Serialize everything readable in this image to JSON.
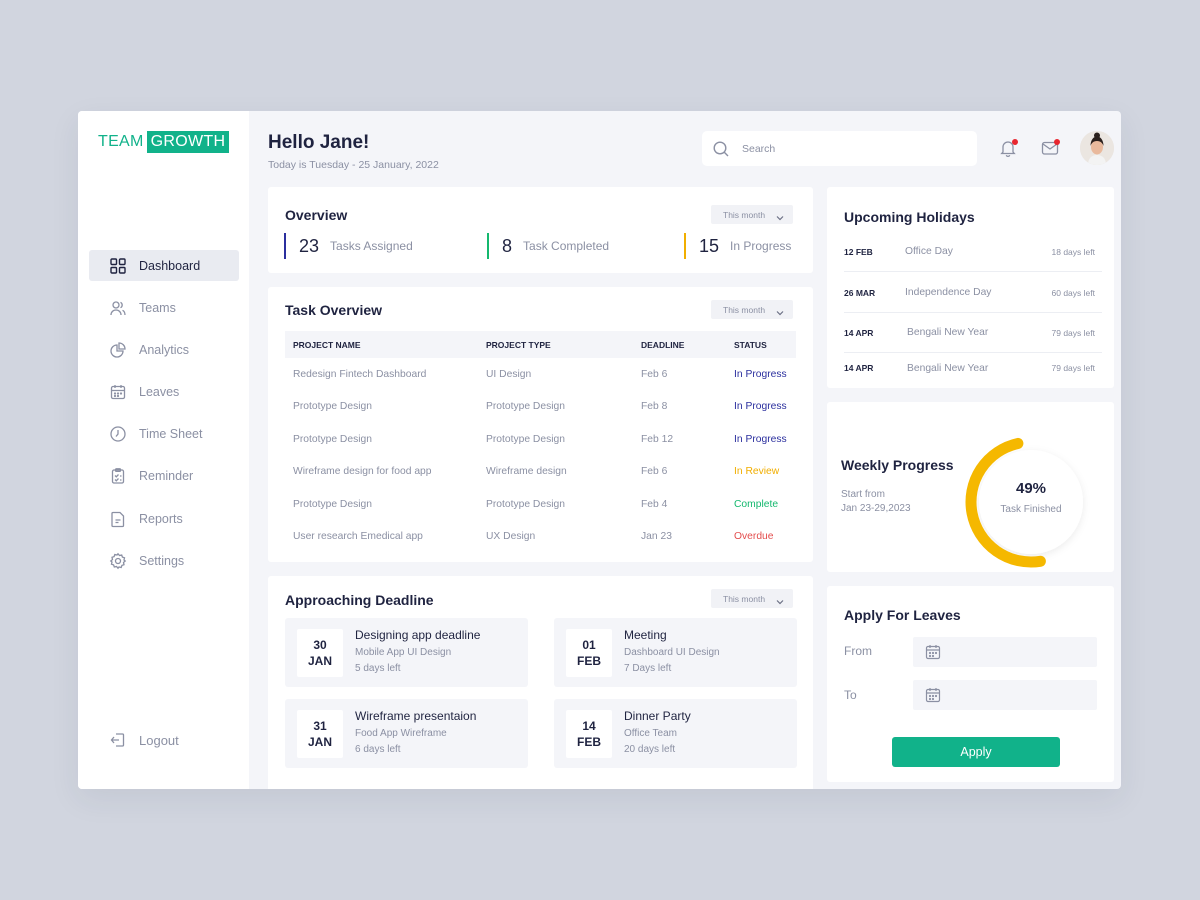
{
  "brand": {
    "part1": "TEAM",
    "part2": "GROWTH"
  },
  "colors": {
    "accent": "#11b28a",
    "in_progress": "#2b2f9e",
    "in_review": "#f1ae00",
    "complete": "#14b86e",
    "overdue": "#e34d4d",
    "ring": "#f5b800"
  },
  "sidebar": {
    "items": [
      {
        "label": "Dashboard",
        "icon": "dashboard-icon"
      },
      {
        "label": "Teams",
        "icon": "users-icon"
      },
      {
        "label": "Analytics",
        "icon": "analytics-icon"
      },
      {
        "label": "Leaves",
        "icon": "calendar-icon"
      },
      {
        "label": "Time Sheet",
        "icon": "clock-icon"
      },
      {
        "label": "Reminder",
        "icon": "clipboard-icon"
      },
      {
        "label": "Reports",
        "icon": "report-icon"
      },
      {
        "label": "Settings",
        "icon": "gear-icon"
      }
    ],
    "logout": "Logout"
  },
  "header": {
    "greeting": "Hello Jane!",
    "date_line": "Today is Tuesday - 25 January, 2022",
    "search_placeholder": "Search"
  },
  "overview": {
    "title": "Overview",
    "filter": "This month",
    "stats": [
      {
        "value": "23",
        "label": "Tasks Assigned",
        "color": "#2b2f9e"
      },
      {
        "value": "8",
        "label": "Task Completed",
        "color": "#14b86e"
      },
      {
        "value": "15",
        "label": "In Progress",
        "color": "#f1ae00"
      }
    ]
  },
  "task_overview": {
    "title": "Task Overview",
    "filter": "This month",
    "columns": [
      "PROJECT NAME",
      "PROJECT TYPE",
      "DEADLINE",
      "STATUS"
    ],
    "rows": [
      {
        "name": "Redesign Fintech Dashboard",
        "type": "UI Design",
        "deadline": "Feb 6",
        "status": "In Progress",
        "status_color": "#2b2f9e"
      },
      {
        "name": "Prototype Design",
        "type": "Prototype Design",
        "deadline": "Feb 8",
        "status": "In Progress",
        "status_color": "#2b2f9e"
      },
      {
        "name": "Prototype Design",
        "type": "Prototype Design",
        "deadline": "Feb 12",
        "status": "In Progress",
        "status_color": "#2b2f9e"
      },
      {
        "name": "Wireframe design for food app",
        "type": "Wireframe design",
        "deadline": "Feb 6",
        "status": "In Review",
        "status_color": "#f1ae00"
      },
      {
        "name": "Prototype Design",
        "type": "Prototype Design",
        "deadline": "Feb 4",
        "status": "Complete",
        "status_color": "#14b86e"
      },
      {
        "name": "User research Emedical app",
        "type": "UX Design",
        "deadline": "Jan 23",
        "status": "Overdue",
        "status_color": "#e34d4d"
      }
    ]
  },
  "deadlines": {
    "title": "Approaching Deadline",
    "filter": "This month",
    "items": [
      {
        "day": "30",
        "month": "JAN",
        "title": "Designing app deadline",
        "sub": "Mobile App UI Design",
        "left": "5 days left"
      },
      {
        "day": "01",
        "month": "FEB",
        "title": "Meeting",
        "sub": "Dashboard UI Design",
        "left": "7 Days left"
      },
      {
        "day": "31",
        "month": "JAN",
        "title": "Wireframe presentaion",
        "sub": "Food App Wireframe",
        "left": "6 days left"
      },
      {
        "day": "14",
        "month": "FEB",
        "title": "Dinner Party",
        "sub": "Office Team",
        "left": "20 days left"
      }
    ]
  },
  "holidays": {
    "title": "Upcoming Holidays",
    "items": [
      {
        "date": "12 FEB",
        "name": "Office Day",
        "left": "18 days left"
      },
      {
        "date": "26 MAR",
        "name": "Independence Day",
        "left": "60 days left"
      },
      {
        "date": "14 APR",
        "name": "Bengali New Year",
        "left": "79 days left"
      },
      {
        "date": "14 APR",
        "name": "Bengali New Year",
        "left": "79 days left"
      }
    ]
  },
  "weekly_progress": {
    "title": "Weekly Progress",
    "sub1": "Start from",
    "sub2": "Jan 23-29,2023",
    "percent_text": "49%",
    "percent_value": 0.49,
    "caption": "Task Finished"
  },
  "leaves": {
    "title": "Apply For Leaves",
    "from_label": "From",
    "to_label": "To",
    "apply_label": "Apply"
  }
}
